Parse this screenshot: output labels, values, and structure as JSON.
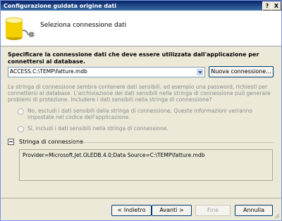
{
  "window": {
    "title": "Configurazione guidata origine dati",
    "help_label": "?",
    "close_label": "X"
  },
  "header": {
    "title": "Seleziona connessione dati",
    "icon": "database-plug-icon"
  },
  "instructions": "Specificare la connessione dati che deve essere utilizzata dall'applicazione per connettersi al database.",
  "connection": {
    "selected": "ACCESS.C:\\TEMP\\fatture.mdb",
    "new_button": "Nuova connessione..."
  },
  "sensitive_info": "La stringa di connessione sembra contenere dati sensibili, ad esempio una password, richiesti per connettersi al database. L'archiviazione dei dati sensibili nella stringa di connessione può generare problemi di protezione. Includere i dati sensibili nella stringa di connessione?",
  "options": [
    {
      "label": "No, escludi i dati sensibili dalla stringa di connessione. Queste informazioni verranno impostate nel codice dell'applicazione."
    },
    {
      "label": "Sì, includi i dati sensibili nella stringa di connessione."
    }
  ],
  "connection_string": {
    "section_label": "Stringa di connessione",
    "value": "Provider=Microsoft.Jet.OLEDB.4.0;Data Source=C:\\TEMP\\fatture.mdb"
  },
  "buttons": {
    "back": "< Indietro",
    "next": "Avanti >",
    "finish": "Fine",
    "cancel": "Annulla"
  }
}
